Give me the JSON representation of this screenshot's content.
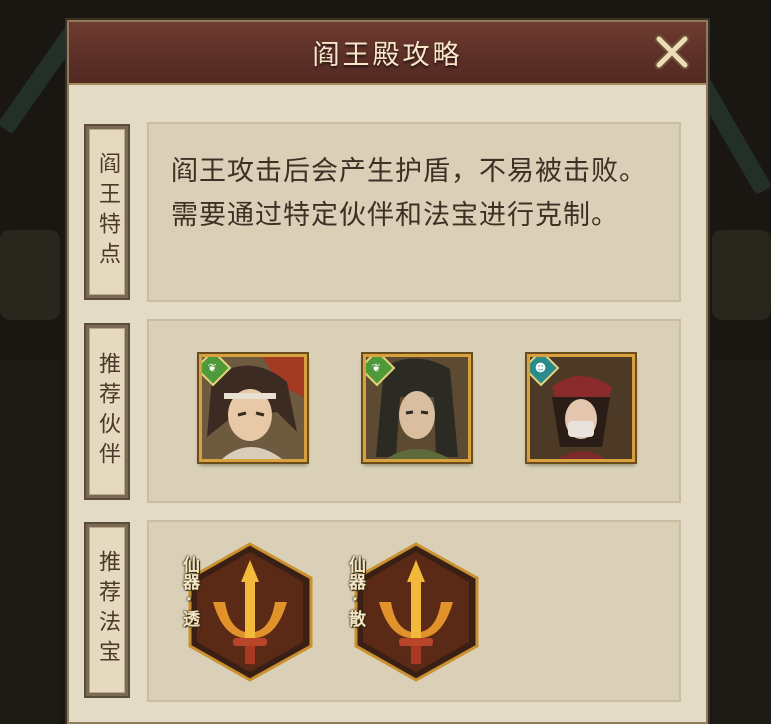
{
  "dialog": {
    "title": "阎王殿攻略",
    "close_icon": "close-x-icon"
  },
  "sections": {
    "features": {
      "label": "阎王特点",
      "description": "阎王攻击后会产生护盾，不易被击败。需要通过特定伙伴和法宝进行克制。"
    },
    "partners": {
      "label": "推荐伙伴",
      "items": [
        {
          "badge_icon": "leaf-icon",
          "badge_color": "#4e9a3a",
          "portrait": "headband-warrior-portrait"
        },
        {
          "badge_icon": "leaf-icon",
          "badge_color": "#4e9a3a",
          "portrait": "long-hair-swordsman-portrait"
        },
        {
          "badge_icon": "demon-mask-icon",
          "badge_color": "#2a8c8a",
          "portrait": "masked-girl-portrait"
        }
      ]
    },
    "treasures": {
      "label": "推荐法宝",
      "items": [
        {
          "tag": "仙器·透",
          "icon": "golden-trident-icon"
        },
        {
          "tag": "仙器·散",
          "icon": "golden-trident-icon"
        }
      ]
    }
  },
  "colors": {
    "title_bar": "#5b2f27",
    "panel_bg": "#dacfb7",
    "frame_gold": "#d7a23e"
  }
}
